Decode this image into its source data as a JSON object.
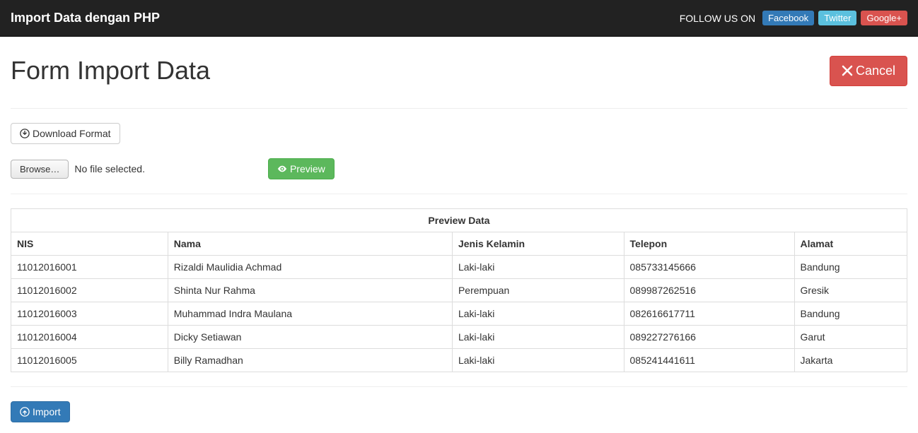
{
  "navbar": {
    "brand": "Import Data dengan PHP",
    "follow_text": "FOLLOW US ON",
    "social": {
      "facebook": "Facebook",
      "twitter": "Twitter",
      "google": "Google+"
    }
  },
  "page": {
    "title": "Form Import Data",
    "cancel_label": "Cancel",
    "download_format_label": "Download Format",
    "browse_label": "Browse…",
    "file_status": "No file selected.",
    "preview_label": "Preview",
    "import_label": "Import"
  },
  "table": {
    "caption": "Preview Data",
    "columns": [
      "NIS",
      "Nama",
      "Jenis Kelamin",
      "Telepon",
      "Alamat"
    ],
    "rows": [
      [
        "11012016001",
        "Rizaldi Maulidia Achmad",
        "Laki-laki",
        "085733145666",
        "Bandung"
      ],
      [
        "11012016002",
        "Shinta Nur Rahma",
        "Perempuan",
        "089987262516",
        "Gresik"
      ],
      [
        "11012016003",
        "Muhammad Indra Maulana",
        "Laki-laki",
        "082616617711",
        "Bandung"
      ],
      [
        "11012016004",
        "Dicky Setiawan",
        "Laki-laki",
        "089227276166",
        "Garut"
      ],
      [
        "11012016005",
        "Billy Ramadhan",
        "Laki-laki",
        "085241441611",
        "Jakarta"
      ]
    ]
  }
}
